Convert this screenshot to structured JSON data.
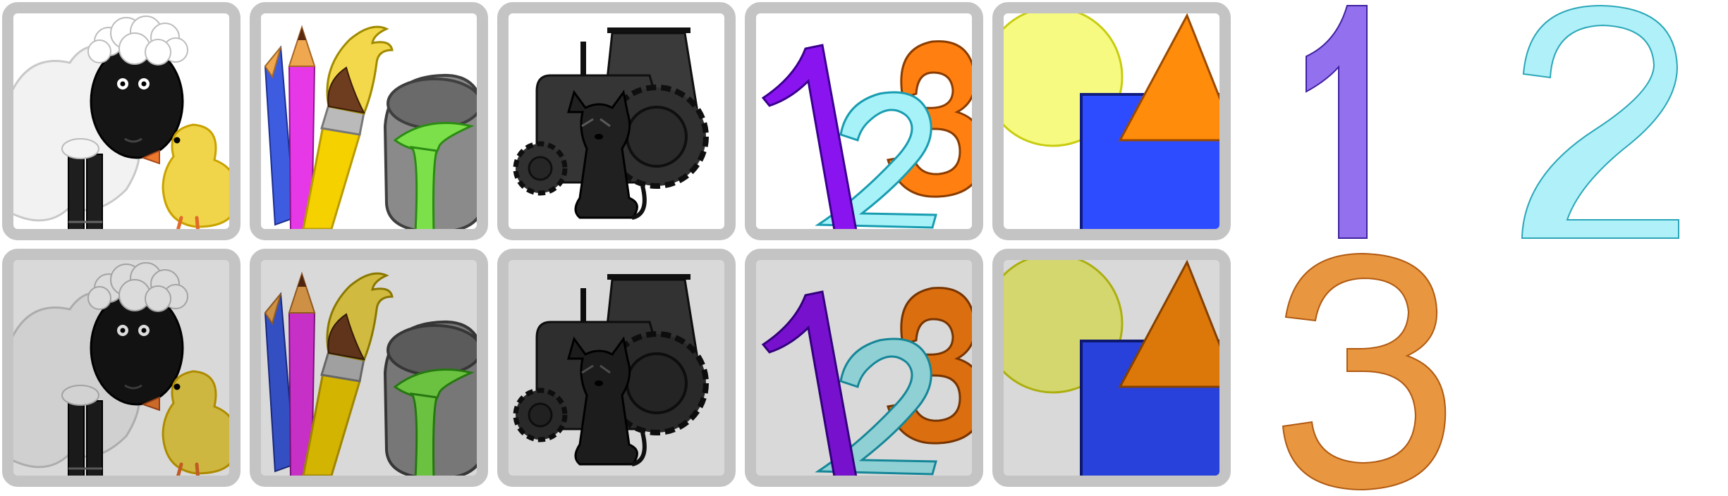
{
  "theme": {
    "tile_border": "#c4c4c4",
    "tile_background_light": "#ffffff",
    "tile_background_dim": "#d9d9d9"
  },
  "tile_rows": [
    {
      "name": "upper-row",
      "state": "light",
      "tiles": [
        {
          "id": "farm-animals",
          "icon": "sheep-and-duck-icon"
        },
        {
          "id": "drawing",
          "icon": "pencils-brush-paint-icon"
        },
        {
          "id": "tractor",
          "icon": "tractor-and-dog-icon"
        },
        {
          "id": "numbers",
          "icon": "numbers-123-icon"
        },
        {
          "id": "shapes",
          "icon": "circle-square-triangle-icon"
        }
      ]
    },
    {
      "name": "lower-row",
      "state": "dim",
      "tiles": [
        {
          "id": "farm-animals",
          "icon": "sheep-and-duck-icon"
        },
        {
          "id": "drawing",
          "icon": "pencils-brush-paint-icon"
        },
        {
          "id": "tractor",
          "icon": "tractor-and-dog-icon"
        },
        {
          "id": "numbers",
          "icon": "numbers-123-icon"
        },
        {
          "id": "shapes",
          "icon": "circle-square-triangle-icon"
        }
      ]
    }
  ],
  "big_numbers": [
    {
      "text": "1",
      "fill": "#9370ed",
      "stroke": "#3e20a0"
    },
    {
      "text": "2",
      "fill": "#b0f0f8",
      "stroke": "#2aa6b8"
    },
    {
      "text": "3",
      "fill": "#e8963f",
      "stroke": "#b05a12"
    }
  ]
}
